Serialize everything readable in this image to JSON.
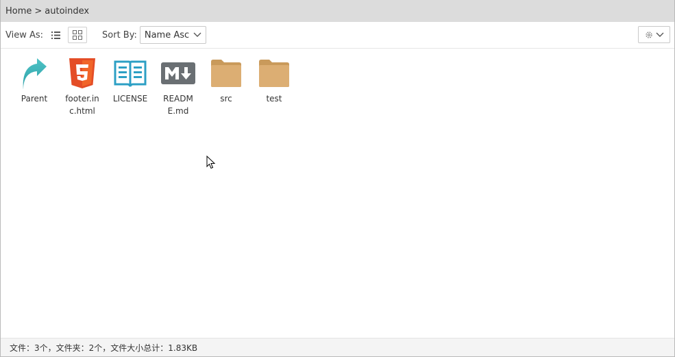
{
  "breadcrumb": {
    "home": "Home",
    "separator": ">",
    "current": "autoindex"
  },
  "toolbar": {
    "view_as_label": "View As:",
    "sort_by_label": "Sort By:",
    "sort_value": "Name Asc"
  },
  "files": [
    {
      "name": "Parent",
      "icon": "parent-arrow-icon"
    },
    {
      "name": "footer.inc.html",
      "icon": "html5-icon"
    },
    {
      "name": "LICENSE",
      "icon": "book-icon"
    },
    {
      "name": "README.md",
      "icon": "markdown-icon"
    },
    {
      "name": "src",
      "icon": "folder-icon"
    },
    {
      "name": "test",
      "icon": "folder-icon"
    }
  ],
  "status": {
    "text": "文件：3个，文件夹：2个，文件大小总计：1.83KB"
  },
  "colors": {
    "html5": "#e44d26",
    "book": "#2c9fc4",
    "markdown": "#6a6f73",
    "folder": "#d9a96a",
    "parent": "#35b3b6"
  }
}
